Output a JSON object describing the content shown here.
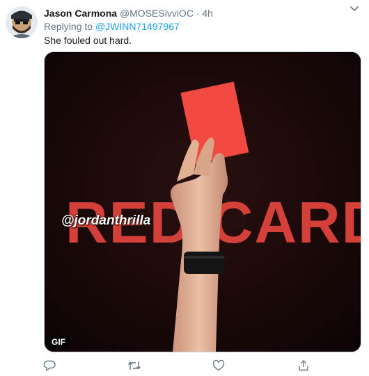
{
  "tweet": {
    "author_name": "Jason Carmona",
    "author_handle": "@MOSESivviOC",
    "separator": "·",
    "time": "4h",
    "reply_prefix": "Replying to",
    "reply_to": "@JWINN71497967",
    "text": "She fouled out hard."
  },
  "media": {
    "image_text": "RED CARD",
    "watermark": "@jordanthrilla",
    "badge": "GIF"
  },
  "actions": {
    "icons": [
      "reply-icon",
      "retweet-icon",
      "like-icon",
      "share-icon"
    ]
  },
  "colors": {
    "link": "#1da1f2",
    "secondary_text": "#657786",
    "card_red": "#f24a40"
  }
}
